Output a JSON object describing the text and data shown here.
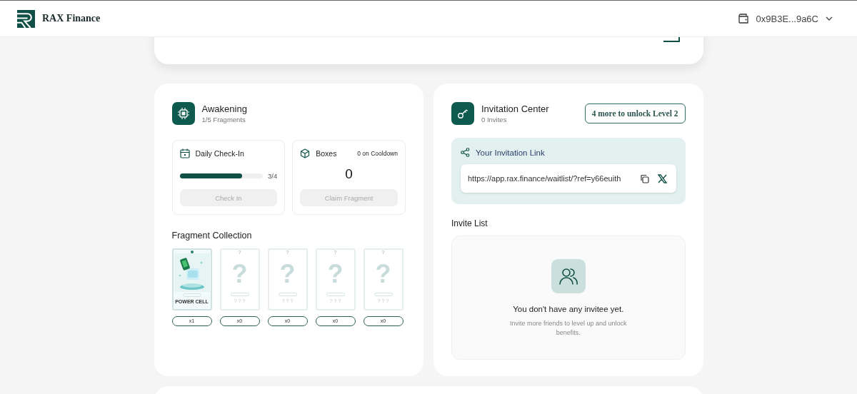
{
  "header": {
    "brand": "RAX Finance",
    "wallet": "0x9B3E...9a6C"
  },
  "awakening": {
    "title": "Awakening",
    "subtitle": "1/5 Fragments",
    "checkin": {
      "title": "Daily Check-In",
      "level": 0.75,
      "reading": "3/4",
      "button": "Check In",
      "disabled": true
    },
    "boxes": {
      "title": "Boxes",
      "cooldown": "0 on Cooldown",
      "count": "0",
      "button": "Claim Fragment",
      "disabled": true
    },
    "collection_title": "Fragment Collection",
    "fragments": [
      {
        "collected": true,
        "name": "POWER CELL",
        "count": "x1"
      },
      {
        "collected": false,
        "top": "?",
        "mark": "?",
        "name": "? ? ?",
        "count": "x0"
      },
      {
        "collected": false,
        "top": "?",
        "mark": "?",
        "name": "? ? ?",
        "count": "x0"
      },
      {
        "collected": false,
        "top": "?",
        "mark": "?",
        "name": "? ? ?",
        "count": "x0"
      },
      {
        "collected": false,
        "top": "?",
        "mark": "?",
        "name": "? ? ?",
        "count": "x0"
      }
    ]
  },
  "invitation": {
    "title": "Invitation Center",
    "subtitle": "0 Invites",
    "badge": "4 more to unlock Level 2",
    "link_title": "Your Invitation Link",
    "link": "https://app.rax.finance/waitlist/?ref=y66euith",
    "list_title": "Invite List",
    "empty_title": "You don't have any invitee yet.",
    "empty_text": "Invite more friends to level up and unlock benefits."
  }
}
